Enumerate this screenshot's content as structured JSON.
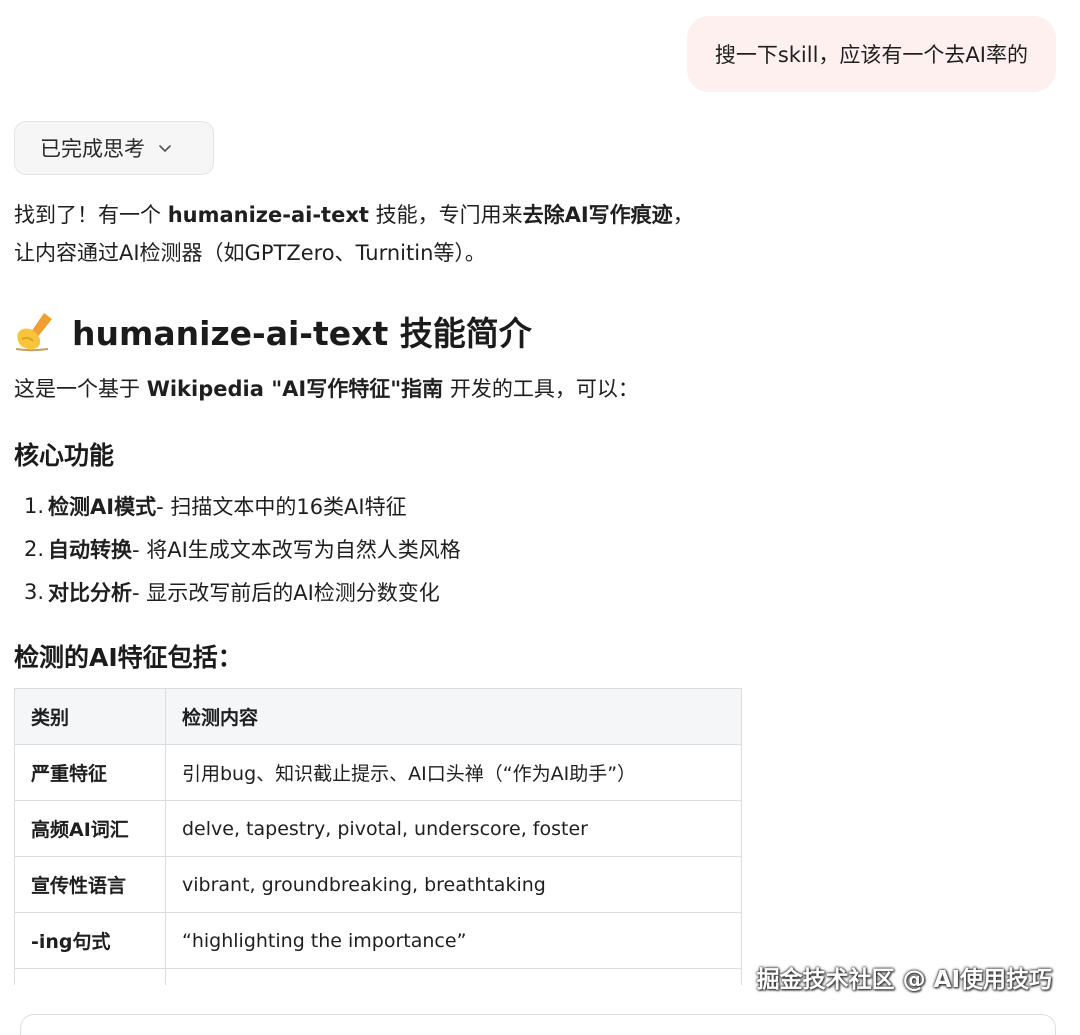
{
  "user_message": "搜一下skill，应该有一个去AI率的",
  "thinking_toggle": {
    "label": "已完成思考"
  },
  "answer": {
    "line1_a": "找到了！有一个 ",
    "line1_b": "humanize-ai-text",
    "line1_c": " 技能，专门用来",
    "line1_d": "去除AI写作痕迹",
    "line1_e": "，",
    "line2": "让内容通过AI检测器（如GPTZero、Turnitin等）。"
  },
  "section_title": "humanize-ai-text 技能简介",
  "intro": {
    "a": "这是一个基于 ",
    "b": "Wikipedia \"AI写作特征\"指南",
    "c": " 开发的工具，可以："
  },
  "core_heading": "核心功能",
  "features": [
    {
      "num": "1.",
      "title": "检测AI模式",
      "desc": " - 扫描文本中的16类AI特征"
    },
    {
      "num": "2.",
      "title": "自动转换",
      "desc": " - 将AI生成文本改写为自然人类风格"
    },
    {
      "num": "3.",
      "title": "对比分析",
      "desc": " - 显示改写前后的AI检测分数变化"
    }
  ],
  "detect_heading": "检测的AI特征包括：",
  "table": {
    "headers": [
      "类别",
      "检测内容"
    ],
    "rows": [
      [
        "严重特征",
        "引用bug、知识截止提示、AI口头禅（“作为AI助手”）"
      ],
      [
        "高频AI词汇",
        "delve, tapestry, pivotal, underscore, foster"
      ],
      [
        "宣传性语言",
        "vibrant, groundbreaking, breathtaking"
      ],
      [
        "-ing句式",
        "“highlighting the importance”"
      ]
    ]
  },
  "watermark": "掘金技术社区 @ AI使用技巧",
  "colors": {
    "user_bubble": "#fdf0ef",
    "table_header": "#f5f6f8",
    "border": "#dcdcdc"
  },
  "icons": [
    "chevron-down-icon",
    "writing-hand-icon"
  ]
}
